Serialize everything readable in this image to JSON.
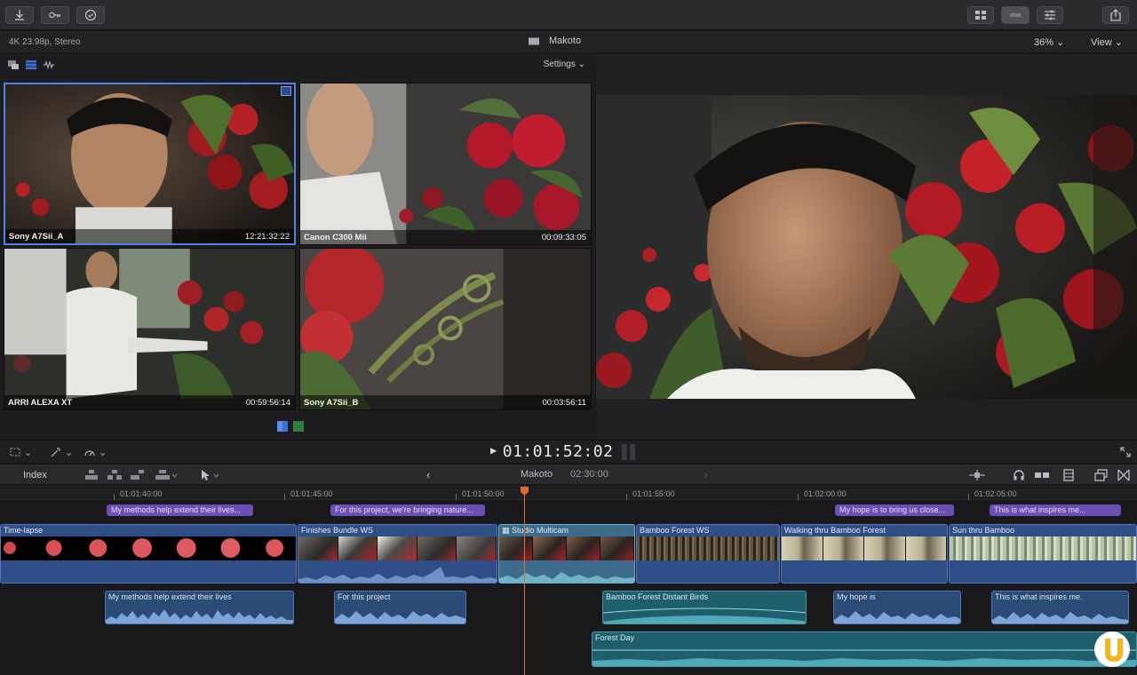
{
  "toolbar": {
    "icons": [
      "import-icon",
      "key-icon",
      "checkmark-icon",
      "browser-layout-icon",
      "timeline-layout-icon",
      "inspector-icon",
      "share-icon"
    ]
  },
  "infobar": {
    "format": "4K 23.98p, Stereo",
    "project": "Makoto",
    "zoom": "36%",
    "view": "View"
  },
  "angle_viewer": {
    "settings": "Settings",
    "angles": [
      {
        "name": "Sony A7Sii_A",
        "timecode": "12:21:32:22"
      },
      {
        "name": "Canon C300 Mii",
        "timecode": "00:09:33:05"
      },
      {
        "name": "ARRI ALEXA XT",
        "timecode": "00:59:56:14"
      },
      {
        "name": "Sony A7Sii_B",
        "timecode": "00:03:56:11"
      }
    ]
  },
  "transport": {
    "timecode": "01:01:52:02"
  },
  "timeline_header": {
    "index": "Index",
    "project": "Makoto",
    "duration": "02:30:00"
  },
  "ruler": {
    "labels": [
      "01:01:40:00",
      "01:01:45:00",
      "01:01:50:00",
      "01:01:55:00",
      "01:02:00:00",
      "01:02:05:00"
    ]
  },
  "markers": [
    "My methods help extend their lives...",
    "For this project, we're bringing nature...",
    "My hope is to bring us close...",
    "This is what inspires me..."
  ],
  "video_clips": [
    "Time-lapse",
    "Finishes Bundle WS",
    "Studio Multicam",
    "Bamboo Forest WS",
    "Walking thru Bamboo Forest",
    "Sun thru Bamboo"
  ],
  "audio_clips": [
    "My methods help extend their lives",
    "For this project",
    "Bamboo Forest Distant Birds",
    "My hope is",
    "This is what inspires me.",
    "Forest Day"
  ],
  "colors": {
    "selection": "#4f82e6",
    "playhead": "#e06a2f",
    "marker": "#6b4fb5",
    "video_clip": "#2f4e86",
    "audio_clip": "#2a4b75",
    "audio_teal": "#1e5f6b"
  }
}
